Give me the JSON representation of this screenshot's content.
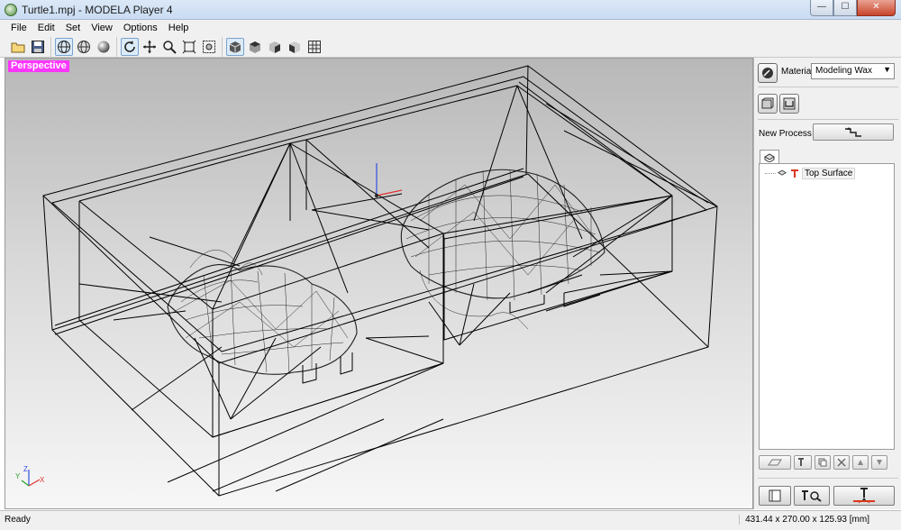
{
  "window": {
    "title": "Turtle1.mpj - MODELA Player 4",
    "minimize": "—",
    "maximize": "☐",
    "close": "✕"
  },
  "menu": [
    "File",
    "Edit",
    "Set",
    "View",
    "Options",
    "Help"
  ],
  "toolbar": {
    "icons": [
      "open-icon",
      "save-icon",
      "wireframe-view-icon",
      "globe-icon",
      "shaded-sphere-icon",
      "rotate-icon",
      "pan-icon",
      "zoom-icon",
      "zoom-fit-icon",
      "zoom-window-icon",
      "view-cube-front-icon",
      "view-cube-top-icon",
      "view-cube-right-icon",
      "view-cube-iso-icon",
      "view-grid-icon"
    ]
  },
  "viewport": {
    "label": "Perspective",
    "axes": {
      "x": "X",
      "y": "Y",
      "z": "Z"
    }
  },
  "panel": {
    "material_label": "Material",
    "material_value": "Modeling Wax",
    "new_process_label": "New Process",
    "tree": [
      {
        "label": "Top Surface"
      }
    ]
  },
  "colors": {
    "view_label_bg": "#ff36ff",
    "tree_icon": "#d9381e",
    "axis_x": "#e03030",
    "axis_y": "#2aa02a",
    "axis_z": "#3050e0"
  },
  "status": {
    "left": "Ready",
    "right": "431.44 x 270.00 x 125.93 [mm]"
  }
}
